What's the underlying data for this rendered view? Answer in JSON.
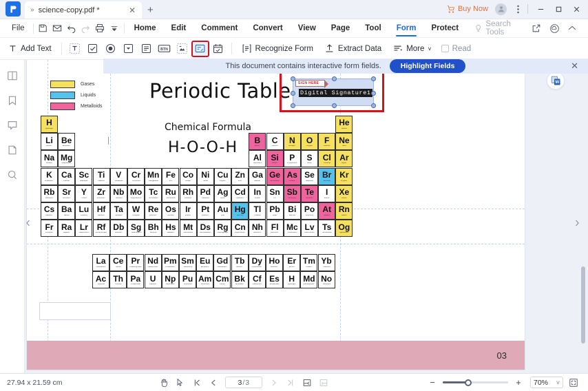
{
  "window": {
    "app_name": "PDFelement",
    "tab_title": "science-copy.pdf *",
    "new_tab_label": "+",
    "buy_now_label": "Buy Now",
    "minimize_label": "–",
    "maximize_label": "☐",
    "close_label": "✕",
    "tab_close_label": "✕",
    "tab_chevron_label": "»"
  },
  "menubar": {
    "file_label": "File",
    "tabs": [
      {
        "label": "Home",
        "active": false
      },
      {
        "label": "Edit",
        "active": false
      },
      {
        "label": "Comment",
        "active": false
      },
      {
        "label": "Convert",
        "active": false
      },
      {
        "label": "View",
        "active": false
      },
      {
        "label": "Page",
        "active": false
      },
      {
        "label": "Tool",
        "active": false
      },
      {
        "label": "Form",
        "active": true
      },
      {
        "label": "Protect",
        "active": false
      }
    ],
    "search_placeholder": "Search Tools",
    "quick_icons": [
      "save-icon",
      "email-icon",
      "undo-icon",
      "redo-icon",
      "print-icon",
      "more-dropdown-icon"
    ],
    "right_icons": [
      "share-icon",
      "cloud-icon",
      "collapse-ribbon-icon"
    ]
  },
  "ribbon": {
    "add_text_label": "Add Text",
    "field_tools": [
      {
        "name": "text-field-tool",
        "glyph": "T"
      },
      {
        "name": "check-box-tool",
        "glyph": "☑"
      },
      {
        "name": "radio-button-tool",
        "glyph": "◉"
      },
      {
        "name": "combo-box-tool",
        "glyph": "▾"
      },
      {
        "name": "list-box-tool",
        "glyph": "≡"
      },
      {
        "name": "push-button-tool",
        "glyph": "BTN"
      },
      {
        "name": "image-field-tool",
        "glyph": "▣"
      },
      {
        "name": "digital-signature-tool",
        "glyph": "✎",
        "selected": true
      },
      {
        "name": "date-field-tool",
        "glyph": "Ὄ5"
      }
    ],
    "recognize_form_label": "Recognize Form",
    "extract_data_label": "Extract Data",
    "more_label": "More",
    "more_caret": "˅",
    "read_label": "Read"
  },
  "notice": {
    "text": "This document contains interactive form fields.",
    "button_label": "Highlight Fields",
    "close_label": "✕"
  },
  "leftrail": {
    "items": [
      {
        "name": "thumbnails-icon"
      },
      {
        "name": "bookmarks-icon"
      },
      {
        "name": "comments-icon"
      },
      {
        "name": "attachments-icon"
      },
      {
        "name": "search-icon"
      }
    ]
  },
  "document": {
    "title": "Periodic Table",
    "subtitle": "Chemical Formula",
    "formula": "H-O-O-H",
    "page_number": "03",
    "legend": [
      {
        "label": "Gases",
        "color": "#f5e05f"
      },
      {
        "label": "Liquids",
        "color": "#56c2ec"
      },
      {
        "label": "Metalloids",
        "color": "#f0649d"
      }
    ],
    "signature_field": {
      "tag_label": "SIGN HERE",
      "value": "Digital Signature1"
    },
    "elements": [
      {
        "sym": "H",
        "nm": "Hydrogen",
        "col": 1,
        "row": 1,
        "cls": "gas"
      },
      {
        "sym": "He",
        "nm": "Helium",
        "col": 18,
        "row": 1,
        "cls": "gas"
      },
      {
        "sym": "Li",
        "nm": "Lithium",
        "col": 1,
        "row": 2,
        "cls": ""
      },
      {
        "sym": "Be",
        "nm": "Beryllium",
        "col": 2,
        "row": 2,
        "cls": ""
      },
      {
        "sym": "B",
        "nm": "Boron",
        "col": 13,
        "row": 2,
        "cls": "met"
      },
      {
        "sym": "C",
        "nm": "Carbon",
        "col": 14,
        "row": 2,
        "cls": ""
      },
      {
        "sym": "N",
        "nm": "Nitrogen",
        "col": 15,
        "row": 2,
        "cls": "gas"
      },
      {
        "sym": "O",
        "nm": "Oxygen",
        "col": 16,
        "row": 2,
        "cls": "gas"
      },
      {
        "sym": "F",
        "nm": "Fluorine",
        "col": 17,
        "row": 2,
        "cls": "gas"
      },
      {
        "sym": "Ne",
        "nm": "Neon",
        "col": 18,
        "row": 2,
        "cls": "gas"
      },
      {
        "sym": "Na",
        "nm": "Sodium",
        "col": 1,
        "row": 3,
        "cls": ""
      },
      {
        "sym": "Mg",
        "nm": "Magnesium",
        "col": 2,
        "row": 3,
        "cls": ""
      },
      {
        "sym": "Al",
        "nm": "Aluminium",
        "col": 13,
        "row": 3,
        "cls": ""
      },
      {
        "sym": "Si",
        "nm": "Silicon",
        "col": 14,
        "row": 3,
        "cls": "met"
      },
      {
        "sym": "P",
        "nm": "Phosphorus",
        "col": 15,
        "row": 3,
        "cls": ""
      },
      {
        "sym": "S",
        "nm": "Sulfur",
        "col": 16,
        "row": 3,
        "cls": ""
      },
      {
        "sym": "Cl",
        "nm": "Chlorine",
        "col": 17,
        "row": 3,
        "cls": "gas"
      },
      {
        "sym": "Ar",
        "nm": "Argon",
        "col": 18,
        "row": 3,
        "cls": "gas"
      },
      {
        "sym": "K",
        "nm": "Potassium",
        "col": 1,
        "row": 4,
        "cls": ""
      },
      {
        "sym": "Ca",
        "nm": "Calcium",
        "col": 2,
        "row": 4,
        "cls": ""
      },
      {
        "sym": "Sc",
        "nm": "Scandium",
        "col": 3,
        "row": 4,
        "cls": ""
      },
      {
        "sym": "Ti",
        "nm": "Titanium",
        "col": 4,
        "row": 4,
        "cls": ""
      },
      {
        "sym": "V",
        "nm": "Vanadium",
        "col": 5,
        "row": 4,
        "cls": ""
      },
      {
        "sym": "Cr",
        "nm": "Chromium",
        "col": 6,
        "row": 4,
        "cls": ""
      },
      {
        "sym": "Mn",
        "nm": "Manganese",
        "col": 7,
        "row": 4,
        "cls": ""
      },
      {
        "sym": "Fe",
        "nm": "Iron",
        "col": 8,
        "row": 4,
        "cls": ""
      },
      {
        "sym": "Co",
        "nm": "Cobalt",
        "col": 9,
        "row": 4,
        "cls": ""
      },
      {
        "sym": "Ni",
        "nm": "Nickel",
        "col": 10,
        "row": 4,
        "cls": ""
      },
      {
        "sym": "Cu",
        "nm": "Copper",
        "col": 11,
        "row": 4,
        "cls": ""
      },
      {
        "sym": "Zn",
        "nm": "Zinc",
        "col": 12,
        "row": 4,
        "cls": ""
      },
      {
        "sym": "Ga",
        "nm": "Gallium",
        "col": 13,
        "row": 4,
        "cls": ""
      },
      {
        "sym": "Ge",
        "nm": "Germanium",
        "col": 14,
        "row": 4,
        "cls": "met"
      },
      {
        "sym": "As",
        "nm": "Arsenic",
        "col": 15,
        "row": 4,
        "cls": "met"
      },
      {
        "sym": "Se",
        "nm": "Selenium",
        "col": 16,
        "row": 4,
        "cls": ""
      },
      {
        "sym": "Br",
        "nm": "Bromine",
        "col": 17,
        "row": 4,
        "cls": "liq"
      },
      {
        "sym": "Kr",
        "nm": "Krypton",
        "col": 18,
        "row": 4,
        "cls": "gas"
      },
      {
        "sym": "Rb",
        "nm": "Rubidium",
        "col": 1,
        "row": 5,
        "cls": ""
      },
      {
        "sym": "Sr",
        "nm": "Strontium",
        "col": 2,
        "row": 5,
        "cls": ""
      },
      {
        "sym": "Y",
        "nm": "Yttrium",
        "col": 3,
        "row": 5,
        "cls": ""
      },
      {
        "sym": "Zr",
        "nm": "Zirconium",
        "col": 4,
        "row": 5,
        "cls": ""
      },
      {
        "sym": "Nb",
        "nm": "Niobium",
        "col": 5,
        "row": 5,
        "cls": ""
      },
      {
        "sym": "Mo",
        "nm": "Molybdenum",
        "col": 6,
        "row": 5,
        "cls": ""
      },
      {
        "sym": "Tc",
        "nm": "Technetium",
        "col": 7,
        "row": 5,
        "cls": ""
      },
      {
        "sym": "Ru",
        "nm": "Ruthenium",
        "col": 8,
        "row": 5,
        "cls": ""
      },
      {
        "sym": "Rh",
        "nm": "Rhodium",
        "col": 9,
        "row": 5,
        "cls": ""
      },
      {
        "sym": "Pd",
        "nm": "Palladium",
        "col": 10,
        "row": 5,
        "cls": ""
      },
      {
        "sym": "Ag",
        "nm": "Silver",
        "col": 11,
        "row": 5,
        "cls": ""
      },
      {
        "sym": "Cd",
        "nm": "Cadmium",
        "col": 12,
        "row": 5,
        "cls": ""
      },
      {
        "sym": "In",
        "nm": "Indium",
        "col": 13,
        "row": 5,
        "cls": ""
      },
      {
        "sym": "Sn",
        "nm": "Tin",
        "col": 14,
        "row": 5,
        "cls": ""
      },
      {
        "sym": "Sb",
        "nm": "Antimony",
        "col": 15,
        "row": 5,
        "cls": "met"
      },
      {
        "sym": "Te",
        "nm": "Tellurium",
        "col": 16,
        "row": 5,
        "cls": "met"
      },
      {
        "sym": "I",
        "nm": "Iodine",
        "col": 17,
        "row": 5,
        "cls": ""
      },
      {
        "sym": "Xe",
        "nm": "Xenon",
        "col": 18,
        "row": 5,
        "cls": "gas"
      },
      {
        "sym": "Cs",
        "nm": "Caesium",
        "col": 1,
        "row": 6,
        "cls": ""
      },
      {
        "sym": "Ba",
        "nm": "Barium",
        "col": 2,
        "row": 6,
        "cls": ""
      },
      {
        "sym": "Lu",
        "nm": "Lutetium",
        "col": 3,
        "row": 6,
        "cls": ""
      },
      {
        "sym": "Hf",
        "nm": "Hafnium",
        "col": 4,
        "row": 6,
        "cls": ""
      },
      {
        "sym": "Ta",
        "nm": "Tantalum",
        "col": 5,
        "row": 6,
        "cls": ""
      },
      {
        "sym": "W",
        "nm": "Tungsten",
        "col": 6,
        "row": 6,
        "cls": ""
      },
      {
        "sym": "Re",
        "nm": "Rhenium",
        "col": 7,
        "row": 6,
        "cls": ""
      },
      {
        "sym": "Os",
        "nm": "Osmium",
        "col": 8,
        "row": 6,
        "cls": ""
      },
      {
        "sym": "Ir",
        "nm": "Iridium",
        "col": 9,
        "row": 6,
        "cls": ""
      },
      {
        "sym": "Pt",
        "nm": "Platinum",
        "col": 10,
        "row": 6,
        "cls": ""
      },
      {
        "sym": "Au",
        "nm": "Gold",
        "col": 11,
        "row": 6,
        "cls": ""
      },
      {
        "sym": "Hg",
        "nm": "Mercury",
        "col": 12,
        "row": 6,
        "cls": "liq"
      },
      {
        "sym": "Tl",
        "nm": "Thallium",
        "col": 13,
        "row": 6,
        "cls": ""
      },
      {
        "sym": "Pb",
        "nm": "Lead",
        "col": 14,
        "row": 6,
        "cls": ""
      },
      {
        "sym": "Bi",
        "nm": "Bismuth",
        "col": 15,
        "row": 6,
        "cls": ""
      },
      {
        "sym": "Po",
        "nm": "Polonium",
        "col": 16,
        "row": 6,
        "cls": ""
      },
      {
        "sym": "At",
        "nm": "Astatine",
        "col": 17,
        "row": 6,
        "cls": "met"
      },
      {
        "sym": "Rn",
        "nm": "Radon",
        "col": 18,
        "row": 6,
        "cls": "gas"
      },
      {
        "sym": "Fr",
        "nm": "Francium",
        "col": 1,
        "row": 7,
        "cls": ""
      },
      {
        "sym": "Ra",
        "nm": "Radium",
        "col": 2,
        "row": 7,
        "cls": ""
      },
      {
        "sym": "Lr",
        "nm": "Lawrencium",
        "col": 3,
        "row": 7,
        "cls": ""
      },
      {
        "sym": "Rf",
        "nm": "Rutherfordium",
        "col": 4,
        "row": 7,
        "cls": ""
      },
      {
        "sym": "Db",
        "nm": "Dubnium",
        "col": 5,
        "row": 7,
        "cls": ""
      },
      {
        "sym": "Sg",
        "nm": "Seaborgium",
        "col": 6,
        "row": 7,
        "cls": ""
      },
      {
        "sym": "Bh",
        "nm": "Bohrium",
        "col": 7,
        "row": 7,
        "cls": ""
      },
      {
        "sym": "Hs",
        "nm": "Hassium",
        "col": 8,
        "row": 7,
        "cls": ""
      },
      {
        "sym": "Mt",
        "nm": "Meitnerium",
        "col": 9,
        "row": 7,
        "cls": ""
      },
      {
        "sym": "Ds",
        "nm": "Darmstadtium",
        "col": 10,
        "row": 7,
        "cls": ""
      },
      {
        "sym": "Rg",
        "nm": "Roentgenium",
        "col": 11,
        "row": 7,
        "cls": ""
      },
      {
        "sym": "Cn",
        "nm": "Copernicium",
        "col": 12,
        "row": 7,
        "cls": ""
      },
      {
        "sym": "Nh",
        "nm": "Nihonium",
        "col": 13,
        "row": 7,
        "cls": ""
      },
      {
        "sym": "Fl",
        "nm": "Flerovium",
        "col": 14,
        "row": 7,
        "cls": ""
      },
      {
        "sym": "Mc",
        "nm": "Moscovium",
        "col": 15,
        "row": 7,
        "cls": ""
      },
      {
        "sym": "Lv",
        "nm": "Livermorium",
        "col": 16,
        "row": 7,
        "cls": ""
      },
      {
        "sym": "Ts",
        "nm": "Tennessine",
        "col": 17,
        "row": 7,
        "cls": ""
      },
      {
        "sym": "Og",
        "nm": "Oganesson",
        "col": 18,
        "row": 7,
        "cls": "gas"
      }
    ],
    "lanthanides": [
      {
        "sym": "La",
        "nm": "Lanthanum"
      },
      {
        "sym": "Ce",
        "nm": "Cerium"
      },
      {
        "sym": "Pr",
        "nm": "Praseodymium"
      },
      {
        "sym": "Nd",
        "nm": "Neodymium"
      },
      {
        "sym": "Pm",
        "nm": "Promethium"
      },
      {
        "sym": "Sm",
        "nm": "Samarium"
      },
      {
        "sym": "Eu",
        "nm": "Europium"
      },
      {
        "sym": "Gd",
        "nm": "Gadolinium"
      },
      {
        "sym": "Tb",
        "nm": "Terbium"
      },
      {
        "sym": "Dy",
        "nm": "Dysprosium"
      },
      {
        "sym": "Ho",
        "nm": "Holmium"
      },
      {
        "sym": "Er",
        "nm": "Erbium"
      },
      {
        "sym": "Tm",
        "nm": "Thulium"
      },
      {
        "sym": "Yb",
        "nm": "Ytterbium"
      }
    ],
    "actinides": [
      {
        "sym": "Ac",
        "nm": "Actinium"
      },
      {
        "sym": "Th",
        "nm": "Thorium"
      },
      {
        "sym": "Pa",
        "nm": "Protactinium"
      },
      {
        "sym": "U",
        "nm": "Uranium"
      },
      {
        "sym": "Np",
        "nm": "Neptunium"
      },
      {
        "sym": "Pu",
        "nm": "Plutonium"
      },
      {
        "sym": "Am",
        "nm": "Americium"
      },
      {
        "sym": "Cm",
        "nm": "Curium"
      },
      {
        "sym": "Bk",
        "nm": "Berkelium"
      },
      {
        "sym": "Cf",
        "nm": "Californium"
      },
      {
        "sym": "Es",
        "nm": "Einsteinium"
      },
      {
        "sym": "H",
        "nm": "Hydrogen"
      },
      {
        "sym": "Md",
        "nm": "Mendelevium"
      },
      {
        "sym": "No",
        "nm": "Nobelium"
      }
    ]
  },
  "statusbar": {
    "dimensions": "27.94 x 21.59 cm",
    "page_current": "3",
    "page_separator": "/",
    "page_total": "3",
    "zoom_value": "70%",
    "zoom_minus": "−",
    "zoom_plus": "+",
    "zoom_caret": "˅",
    "tools": [
      "hand-tool-icon",
      "select-tool-icon",
      "first-page-icon",
      "prev-page-icon",
      "next-page-icon",
      "last-page-icon",
      "single-page-icon",
      "continuous-page-icon",
      "fit-page-icon"
    ]
  }
}
